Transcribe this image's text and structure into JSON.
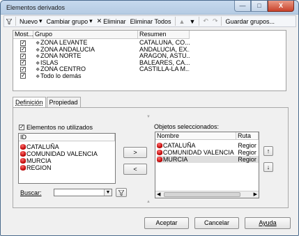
{
  "window": {
    "title": "Elementos derivados",
    "min_label": "—",
    "max_label": "□",
    "close_label": "X"
  },
  "toolbar": {
    "nuevo": "Nuevo",
    "cambiar_grupo": "Cambiar grupo",
    "eliminar": "Eliminar",
    "eliminar_todos": "Eliminar Todos",
    "guardar_grupos": "Guardar grupos..."
  },
  "grid": {
    "headers": [
      "Most...",
      "Grupo",
      "Resumen"
    ],
    "rows": [
      {
        "checked": true,
        "grupo": "ZONA LEVANTE",
        "resumen": "CATALUÑA, CO..."
      },
      {
        "checked": true,
        "grupo": "ZONA ANDALUCIA",
        "resumen": "ANDALUCIA, EX..."
      },
      {
        "checked": true,
        "grupo": "ZONA NORTE",
        "resumen": "ARAGON, ASTU..."
      },
      {
        "checked": true,
        "grupo": "ISLAS",
        "resumen": "BALEARES, CA..."
      },
      {
        "checked": true,
        "grupo": "ZONA CENTRO",
        "resumen": "CASTILLA-LA M..."
      },
      {
        "checked": true,
        "grupo": "Todo lo demás",
        "resumen": ""
      }
    ]
  },
  "tabs": [
    {
      "label": "Definición",
      "selected": true
    },
    {
      "label": "Propiedad",
      "selected": false
    }
  ],
  "left_panel": {
    "checkbox_label": "Elementos no utilizados",
    "checked": true,
    "column": "ID",
    "items": [
      "CATALUÑA",
      "COMUNIDAD VALENCIA",
      "MURCIA",
      "REGION"
    ],
    "search_label": "Buscar:",
    "search_value": ""
  },
  "move_buttons": {
    "add": ">",
    "remove": "<"
  },
  "right_panel": {
    "title": "Objetos seleccionados:",
    "columns": [
      "Nombre",
      "Ruta"
    ],
    "items": [
      {
        "name": "CATALUÑA",
        "ruta": "Regior"
      },
      {
        "name": "COMUNIDAD VALENCIA",
        "ruta": "Regior"
      },
      {
        "name": "MURCIA",
        "ruta": "Regior"
      }
    ]
  },
  "order_buttons": {
    "up": "↑",
    "down": "↓"
  },
  "footer": {
    "ok": "Aceptar",
    "cancel": "Cancelar",
    "help": "Ayuda"
  },
  "colors": {
    "title_bar": "#c6d9ee",
    "db_icon": "#c00000",
    "close_button": "#c8412a"
  }
}
